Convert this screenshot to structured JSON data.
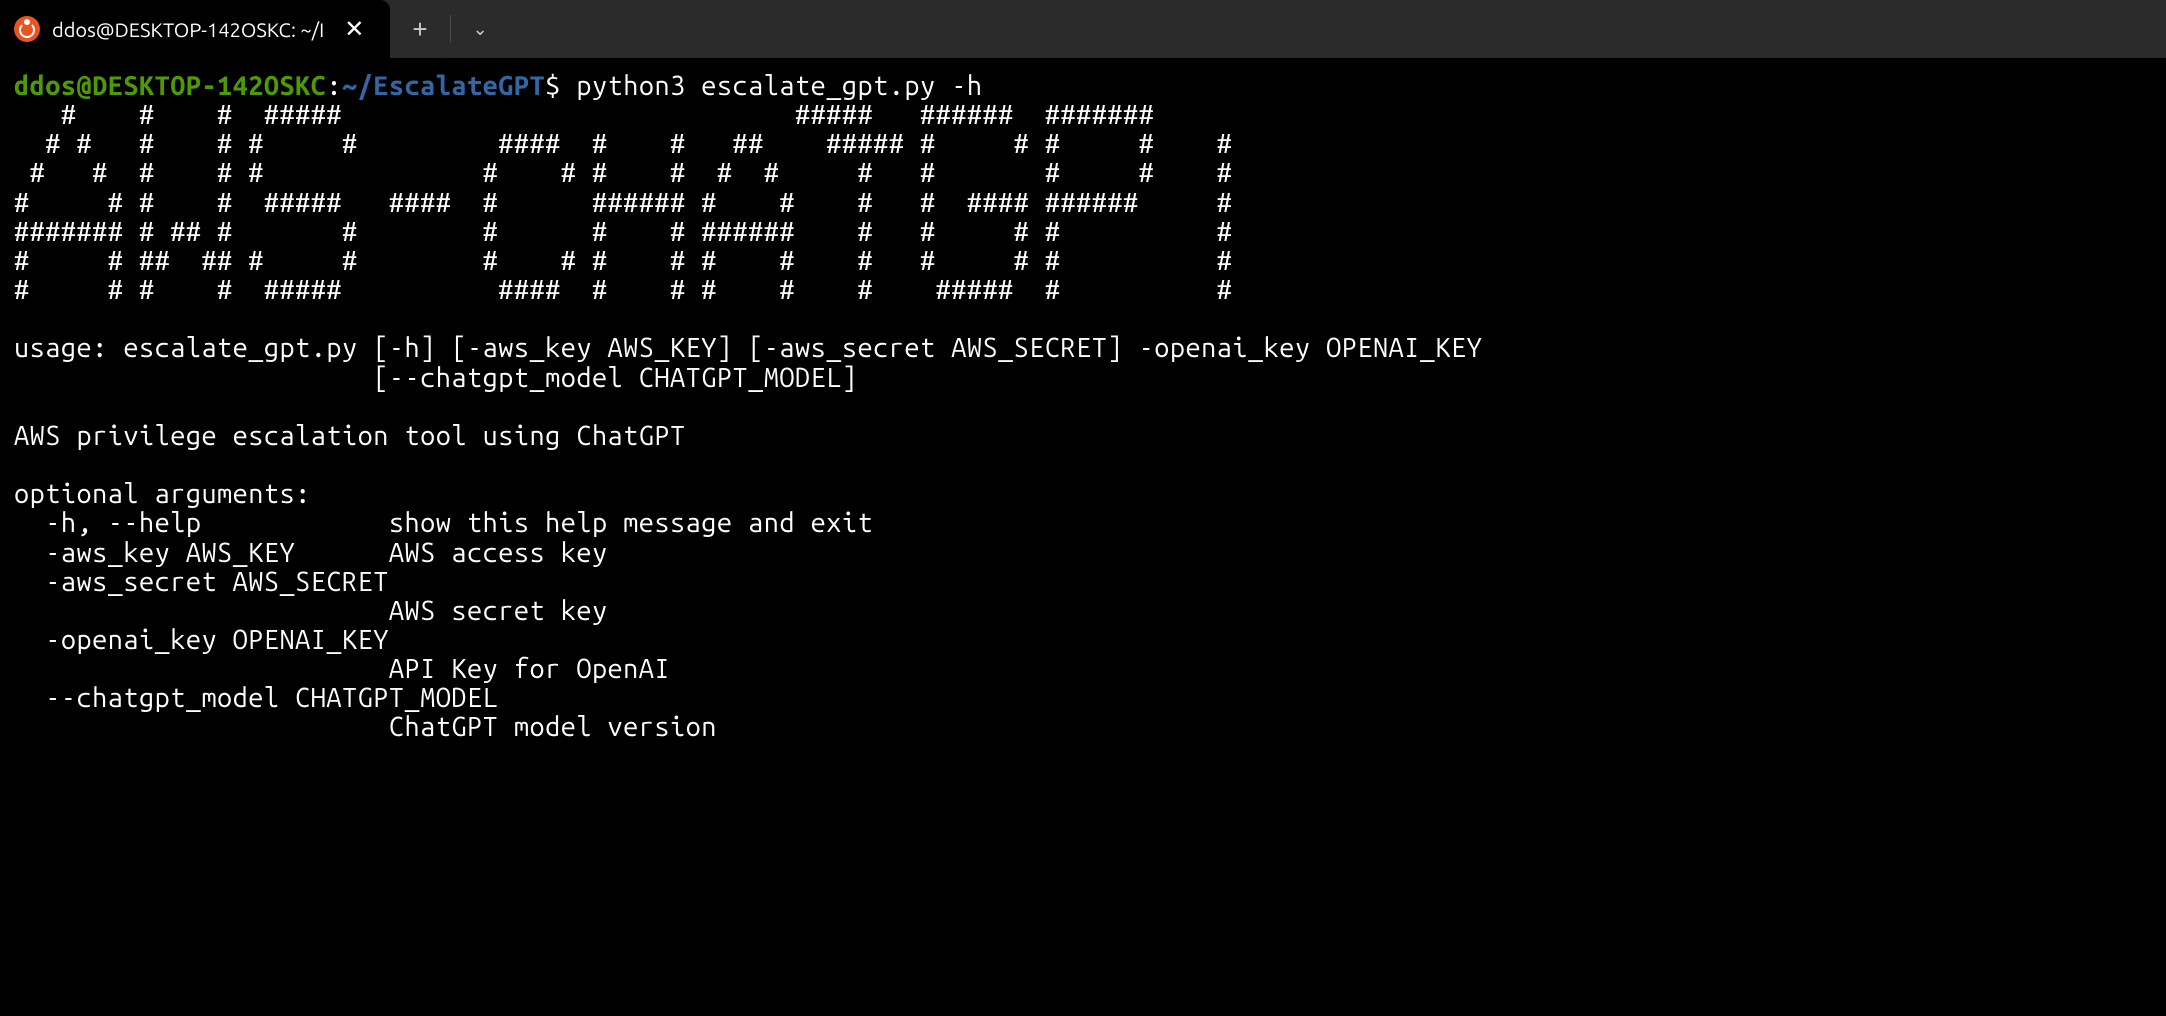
{
  "tab": {
    "title": "ddos@DESKTOP-142OSKC: ~/I"
  },
  "prompt": {
    "user_host": "ddos@DESKTOP-142OSKC",
    "colon": ":",
    "path": "~/EscalateGPT",
    "dollar": "$"
  },
  "command": "python3 escalate_gpt.py -h",
  "ascii_art": "   #    #    #  #####                             #####   ######  #######\n  # #   #    # #     #         ####  #    #   ##    ##### #     # #     #    #\n #   #  #    # #              #    # #    #  #  #     #   #       #     #    #\n#     # #    #  #####   ####  #      ###### #    #    #   #  #### ######     #\n####### # ## #       #        #      #    # ######    #   #     # #          #\n#     # ##  ## #     #        #    # #    # #    #    #   #     # #          #\n#     # #    #  #####          ####  #    # #    #    #    #####  #          #",
  "usage_line1": "usage: escalate_gpt.py [-h] [-aws_key AWS_KEY] [-aws_secret AWS_SECRET] -openai_key OPENAI_KEY",
  "usage_line2": "                       [--chatgpt_model CHATGPT_MODEL]",
  "description": "AWS privilege escalation tool using ChatGPT",
  "optional_header": "optional arguments:",
  "arg_help": "  -h, --help            show this help message and exit",
  "arg_aws_key": "  -aws_key AWS_KEY      AWS access key",
  "arg_aws_secret1": "  -aws_secret AWS_SECRET",
  "arg_aws_secret2": "                        AWS secret key",
  "arg_openai1": "  -openai_key OPENAI_KEY",
  "arg_openai2": "                        API Key for OpenAI",
  "arg_chatgpt1": "  --chatgpt_model CHATGPT_MODEL",
  "arg_chatgpt2": "                        ChatGPT model version"
}
